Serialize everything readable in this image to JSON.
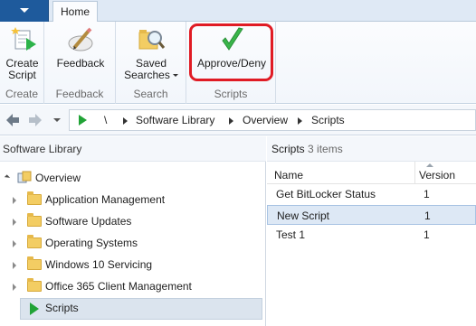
{
  "ribbon": {
    "tabs": [
      {
        "label": "Home"
      }
    ],
    "groups": {
      "create": {
        "label": "Create",
        "button_line1": "Create",
        "button_line2": "Script"
      },
      "feedback": {
        "label": "Feedback",
        "button": "Feedback"
      },
      "search": {
        "label": "Search",
        "button_line1": "Saved",
        "button_line2": "Searches"
      },
      "scripts": {
        "label": "Scripts",
        "button": "Approve/Deny"
      }
    }
  },
  "address_bar": {
    "root_sep": "\\",
    "crumbs": [
      "Software Library",
      "Overview",
      "Scripts"
    ]
  },
  "left_pane": {
    "title": "Software Library",
    "tree": {
      "overview": "Overview",
      "children": [
        "Application Management",
        "Software Updates",
        "Operating Systems",
        "Windows 10 Servicing",
        "Office 365 Client Management",
        "Scripts"
      ]
    }
  },
  "right_pane": {
    "title": "Scripts",
    "count": "3 items",
    "columns": {
      "name": "Name",
      "version": "Version"
    },
    "rows": [
      {
        "name": "Get BitLocker Status",
        "version": "1"
      },
      {
        "name": "New Script",
        "version": "1"
      },
      {
        "name": "Test 1",
        "version": "1"
      }
    ]
  },
  "colors": {
    "accent": "#1e5a9c",
    "approve_check": "#39b54a",
    "highlight": "#e01b24",
    "folder": "#f3cd63",
    "selection": "#dde8f5"
  },
  "icons": [
    "create-script-icon",
    "feedback-icon",
    "saved-searches-icon",
    "approve-deny-icon",
    "back-icon",
    "forward-icon",
    "folder-icon",
    "scripts-node-icon",
    "overview-icon"
  ]
}
